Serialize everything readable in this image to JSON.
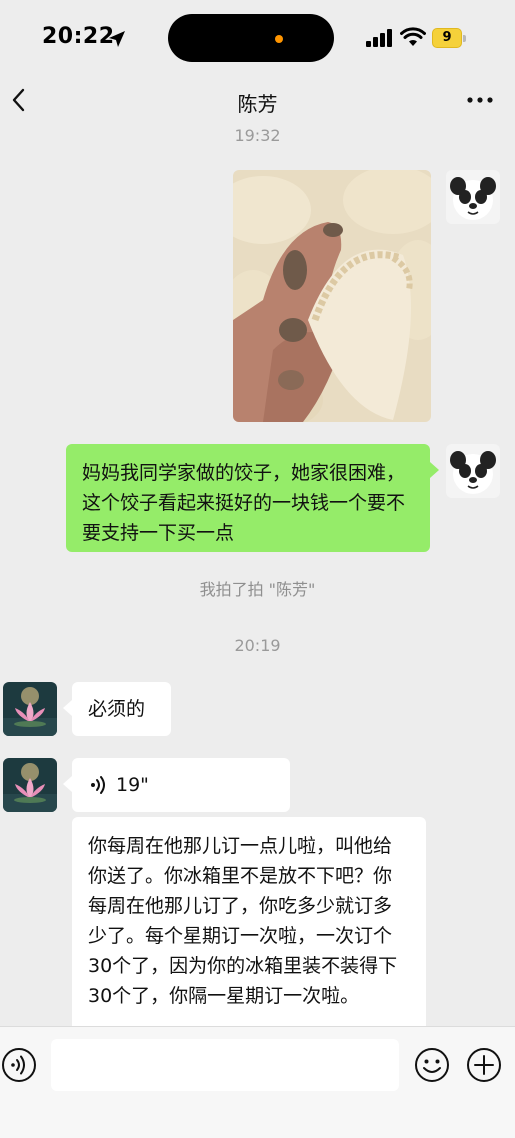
{
  "status": {
    "time": "20:22",
    "battery": "9"
  },
  "header": {
    "title": "陈芳"
  },
  "messages": {
    "ts1": "19:32",
    "sent_text": "妈妈我同学家做的饺子，她家很困难，这个饺子看起来挺好的一块钱一个要不要支持一下买一点",
    "pat": "我拍了拍 \"陈芳\"",
    "ts2": "20:19",
    "reply1": "必须的",
    "voice_duration": "19\"",
    "reply2": "你每周在他那儿订一点儿啦，叫他给你送了。你冰箱里不是放不下吧？你每周在他那儿订了，你吃多少就订多少了。每个星期订一次啦，一次订个30个了，因为你的冰箱里装不装得下30个了，你隔一星期订一次啦。"
  },
  "colors": {
    "sent_bubble": "#95ec69",
    "received_bubble": "#ffffff",
    "background": "#ededed"
  },
  "icons": {
    "back": "chevron-left-icon",
    "more": "more-dots-icon",
    "voice_mode": "voice-mode-icon",
    "emoji": "emoji-icon",
    "add": "plus-circle-icon"
  }
}
